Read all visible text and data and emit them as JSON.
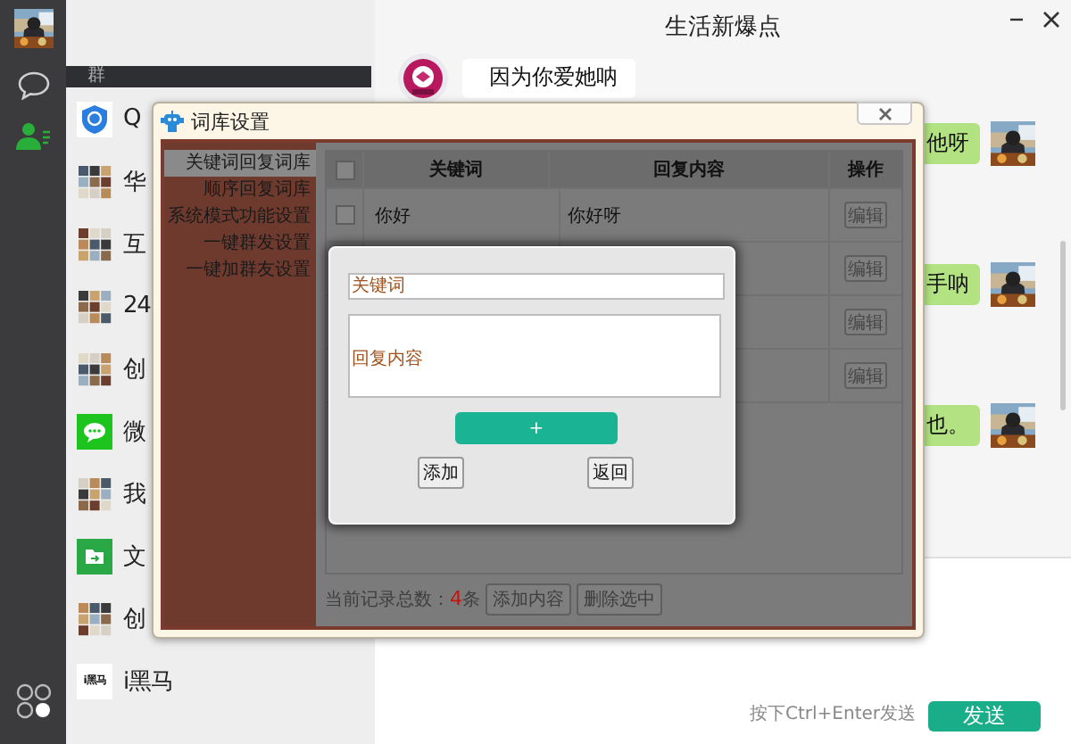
{
  "nav": [
    {
      "kind": "chat",
      "selected": false
    },
    {
      "kind": "contacts",
      "selected": true
    }
  ],
  "contacts": {
    "header": "群",
    "items": [
      {
        "name": "Q",
        "kind": "shield"
      },
      {
        "name": "华",
        "kind": "group"
      },
      {
        "name": "互",
        "kind": "group"
      },
      {
        "name": "24",
        "kind": "group"
      },
      {
        "name": "创",
        "kind": "group"
      },
      {
        "name": "微",
        "kind": "wechat"
      },
      {
        "name": "我",
        "kind": "group"
      },
      {
        "name": "文",
        "kind": "folder"
      },
      {
        "name": "创",
        "kind": "group"
      },
      {
        "name": "i黑马",
        "kind": "logo",
        "logo_text": "i黑马"
      }
    ]
  },
  "chat": {
    "title": "生活新爆点",
    "messages": [
      {
        "kind": "incoming",
        "text": "因为你爱她呐"
      },
      {
        "kind": "outgoing",
        "text": "他呀"
      },
      {
        "kind": "outgoing",
        "text": "手呐"
      },
      {
        "kind": "outgoing",
        "text": "也。"
      }
    ],
    "hint": "按下Ctrl+Enter发送",
    "send": "发送"
  },
  "dialog": {
    "title": "词库设置",
    "menu": [
      {
        "label": "关键词回复词库",
        "selected": true
      },
      {
        "label": "顺序回复词库",
        "selected": false
      },
      {
        "label": "系统模式功能设置",
        "selected": false
      },
      {
        "label": "一键群发设置",
        "selected": false
      },
      {
        "label": "一键加群友设置",
        "selected": false
      }
    ],
    "table": {
      "columns": [
        "关键词",
        "回复内容",
        "操作"
      ],
      "all_checked": false,
      "rows": [
        {
          "checked": false,
          "keyword": "你好",
          "reply": "你好呀",
          "action": "编辑"
        },
        {
          "action": "编辑"
        },
        {
          "action": "编辑"
        },
        {
          "action": "编辑"
        }
      ]
    },
    "footer": {
      "label": "当前记录总数：",
      "count": "4",
      "unit": "条",
      "buttons": [
        "添加内容",
        "删除选中"
      ]
    },
    "modal": {
      "keyword_placeholder": "关键词",
      "reply_placeholder": "回复内容",
      "plus": "+",
      "buttons": [
        "添加",
        "返回"
      ]
    }
  }
}
